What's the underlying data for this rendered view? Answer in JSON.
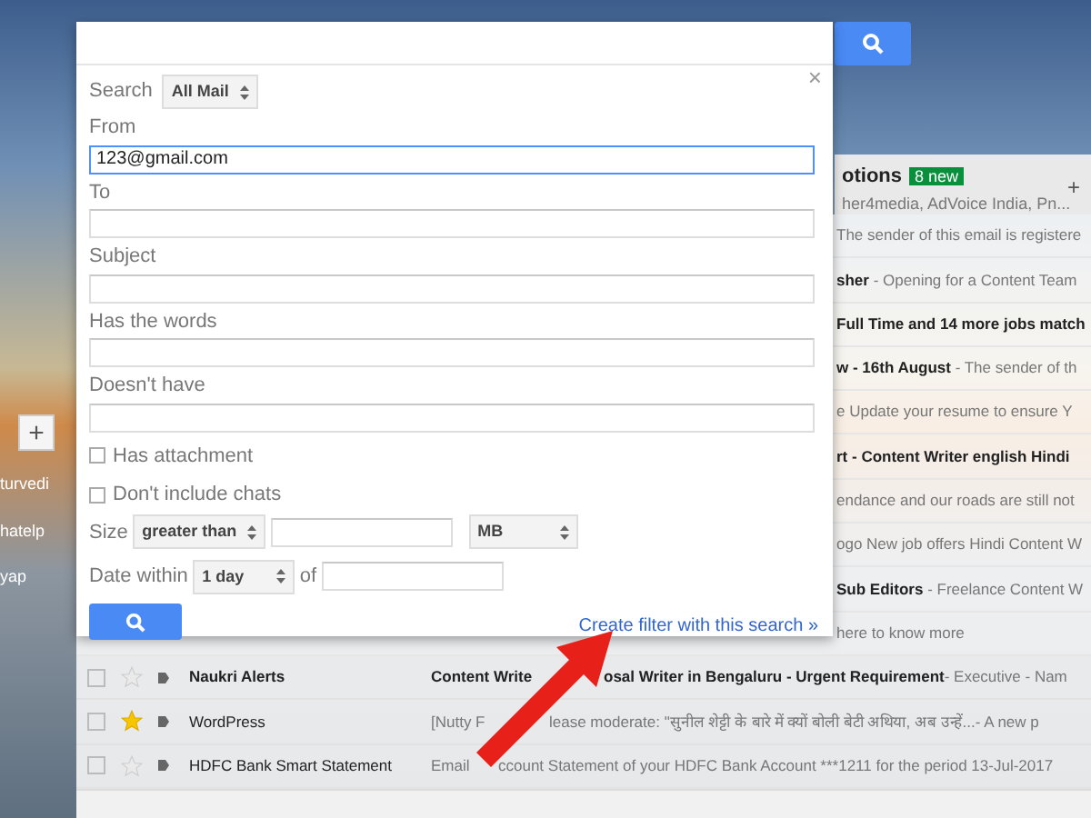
{
  "sidebar": {
    "compose": "+",
    "items": [
      "turvedi",
      "hatelp",
      "yap"
    ]
  },
  "promotions_tab": {
    "label": "otions",
    "badge": "8 new",
    "senders": "her4media, AdVoice India, Pn...",
    "add": "+"
  },
  "background_rows": [
    {
      "parts": [
        {
          "text": "The sender of this email is registere",
          "bold": false
        }
      ]
    },
    {
      "parts": [
        {
          "text": "sher",
          "bold": true
        },
        {
          "text": " - Opening for a Content Team",
          "bold": false
        }
      ]
    },
    {
      "parts": [
        {
          "text": "Full Time and 14 more jobs match",
          "bold": true
        }
      ]
    },
    {
      "parts": [
        {
          "text": "w - 16th August",
          "bold": true
        },
        {
          "text": " - The sender of th",
          "bold": false
        }
      ]
    },
    {
      "parts": [
        {
          "text": "e Update your resume to ensure Y",
          "bold": false
        }
      ]
    },
    {
      "parts": [
        {
          "text": "rt - Content Writer english Hindi",
          "bold": true
        }
      ]
    },
    {
      "parts": [
        {
          "text": "endance and our roads are still not",
          "bold": false
        }
      ]
    },
    {
      "parts": [
        {
          "text": "ogo New job offers Hindi Content W",
          "bold": false
        }
      ]
    },
    {
      "parts": [
        {
          "text": "Sub Editors",
          "bold": true
        },
        {
          "text": " - Freelance Content W",
          "bold": false
        }
      ]
    },
    {
      "parts": [
        {
          "text": "here to know more",
          "bold": false
        }
      ]
    }
  ],
  "mail_rows": [
    {
      "checked": false,
      "sender": "Naukri Alerts",
      "unread": true,
      "starred": false,
      "subject_parts": [
        {
          "text": "Content Write",
          "bold": true
        },
        {
          "text": "osal Writer in Bengaluru - Urgent Requirement",
          "bold": true
        },
        {
          "text": " - Executive - Nam",
          "bold": false
        }
      ]
    },
    {
      "checked": false,
      "sender": "WordPress",
      "unread": false,
      "starred": true,
      "subject_parts": [
        {
          "text": "[Nutty F",
          "bold": false
        },
        {
          "text": "lease moderate: \"सुनील शेट्टी के बारे में क्यों बोली बेटी अथिया, अब उन्हें...",
          "bold": false
        },
        {
          "text": " - A new p",
          "bold": false
        }
      ]
    },
    {
      "checked": false,
      "sender": "HDFC Bank Smart Statement",
      "unread": false,
      "starred": false,
      "subject_parts": [
        {
          "text": "Email",
          "bold": false
        },
        {
          "text": "ccount Statement of your HDFC Bank Account ***1211 for the period 13-Jul-2017",
          "bold": false
        }
      ]
    }
  ],
  "dialog": {
    "close": "×",
    "search_label": "Search",
    "scope": "All Mail",
    "fields": [
      {
        "label": "From",
        "value": "123@gmail.com",
        "focused": true
      },
      {
        "label": "To",
        "focused": false
      },
      {
        "label": "Subject",
        "focused": false
      },
      {
        "label": "Has the words",
        "focused": false
      },
      {
        "label": "Doesn't have",
        "focused": false
      }
    ],
    "checkboxes": [
      {
        "label": "Has attachment",
        "checked": false
      },
      {
        "label": "Don't include chats",
        "checked": false
      }
    ],
    "size": {
      "label": "Size",
      "operator": "greater than",
      "unit": "MB"
    },
    "date": {
      "label": "Date within",
      "range": "1 day",
      "of_label": "of"
    },
    "create_filter_link": "Create filter with this search »"
  }
}
